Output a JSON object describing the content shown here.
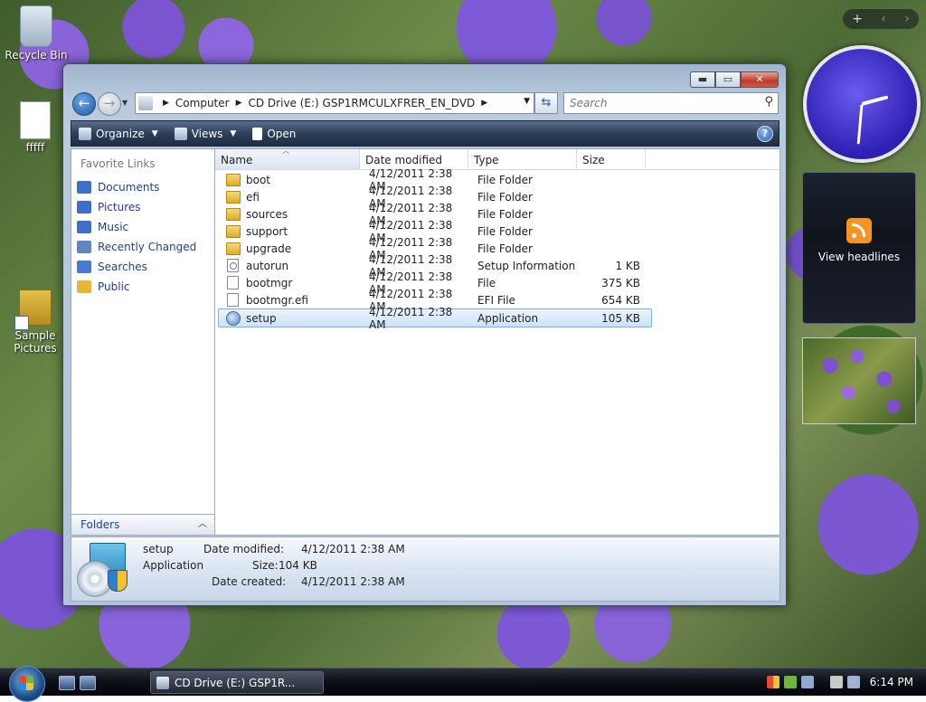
{
  "desktop": {
    "icons": [
      {
        "label": "Recycle Bin"
      },
      {
        "label": "fffff"
      },
      {
        "label": "Sample Pictures"
      }
    ]
  },
  "gadgets": {
    "headlines_label": "View headlines",
    "controls": {
      "add": "+",
      "prev": "‹",
      "next": "›"
    }
  },
  "window": {
    "controls": {
      "minimize": "▬",
      "maximize": "▭",
      "close": "✕"
    },
    "address": {
      "segments": [
        "Computer",
        "CD Drive (E:) GSP1RMCULXFRER_EN_DVD"
      ]
    },
    "search_placeholder": "Search",
    "toolbar": {
      "organize": "Organize",
      "views": "Views",
      "open": "Open",
      "help": "?"
    },
    "favorite_links": {
      "heading": "Favorite Links",
      "items": [
        {
          "label": "Documents",
          "color": "#3d6fc9"
        },
        {
          "label": "Pictures",
          "color": "#3d6fc9"
        },
        {
          "label": "Music",
          "color": "#3d6fc9"
        },
        {
          "label": "Recently Changed",
          "color": "#5f86c0"
        },
        {
          "label": "Searches",
          "color": "#4a7acf"
        },
        {
          "label": "Public",
          "color": "#e6b53a"
        }
      ]
    },
    "folders_label": "Folders",
    "columns": [
      "Name",
      "Date modified",
      "Type",
      "Size"
    ],
    "files": [
      {
        "name": "boot",
        "date": "4/12/2011 2:38 AM",
        "type": "File Folder",
        "size": "",
        "icon": "folder"
      },
      {
        "name": "efi",
        "date": "4/12/2011 2:38 AM",
        "type": "File Folder",
        "size": "",
        "icon": "folder"
      },
      {
        "name": "sources",
        "date": "4/12/2011 2:38 AM",
        "type": "File Folder",
        "size": "",
        "icon": "folder"
      },
      {
        "name": "support",
        "date": "4/12/2011 2:38 AM",
        "type": "File Folder",
        "size": "",
        "icon": "folder"
      },
      {
        "name": "upgrade",
        "date": "4/12/2011 2:38 AM",
        "type": "File Folder",
        "size": "",
        "icon": "folder"
      },
      {
        "name": "autorun",
        "date": "4/12/2011 2:38 AM",
        "type": "Setup Information",
        "size": "1 KB",
        "icon": "inf"
      },
      {
        "name": "bootmgr",
        "date": "4/12/2011 2:38 AM",
        "type": "File",
        "size": "375 KB",
        "icon": "file"
      },
      {
        "name": "bootmgr.efi",
        "date": "4/12/2011 2:38 AM",
        "type": "EFI File",
        "size": "654 KB",
        "icon": "file"
      },
      {
        "name": "setup",
        "date": "4/12/2011 2:38 AM",
        "type": "Application",
        "size": "105 KB",
        "icon": "app",
        "selected": true
      }
    ],
    "details": {
      "name": "setup",
      "type": "Application",
      "modified_label": "Date modified:",
      "modified": "4/12/2011 2:38 AM",
      "size_label": "Size:",
      "size": "104 KB",
      "created_label": "Date created:",
      "created": "4/12/2011 2:38 AM"
    }
  },
  "taskbar": {
    "task_label": "CD Drive (E:) GSP1R...",
    "time": "6:14 PM"
  }
}
